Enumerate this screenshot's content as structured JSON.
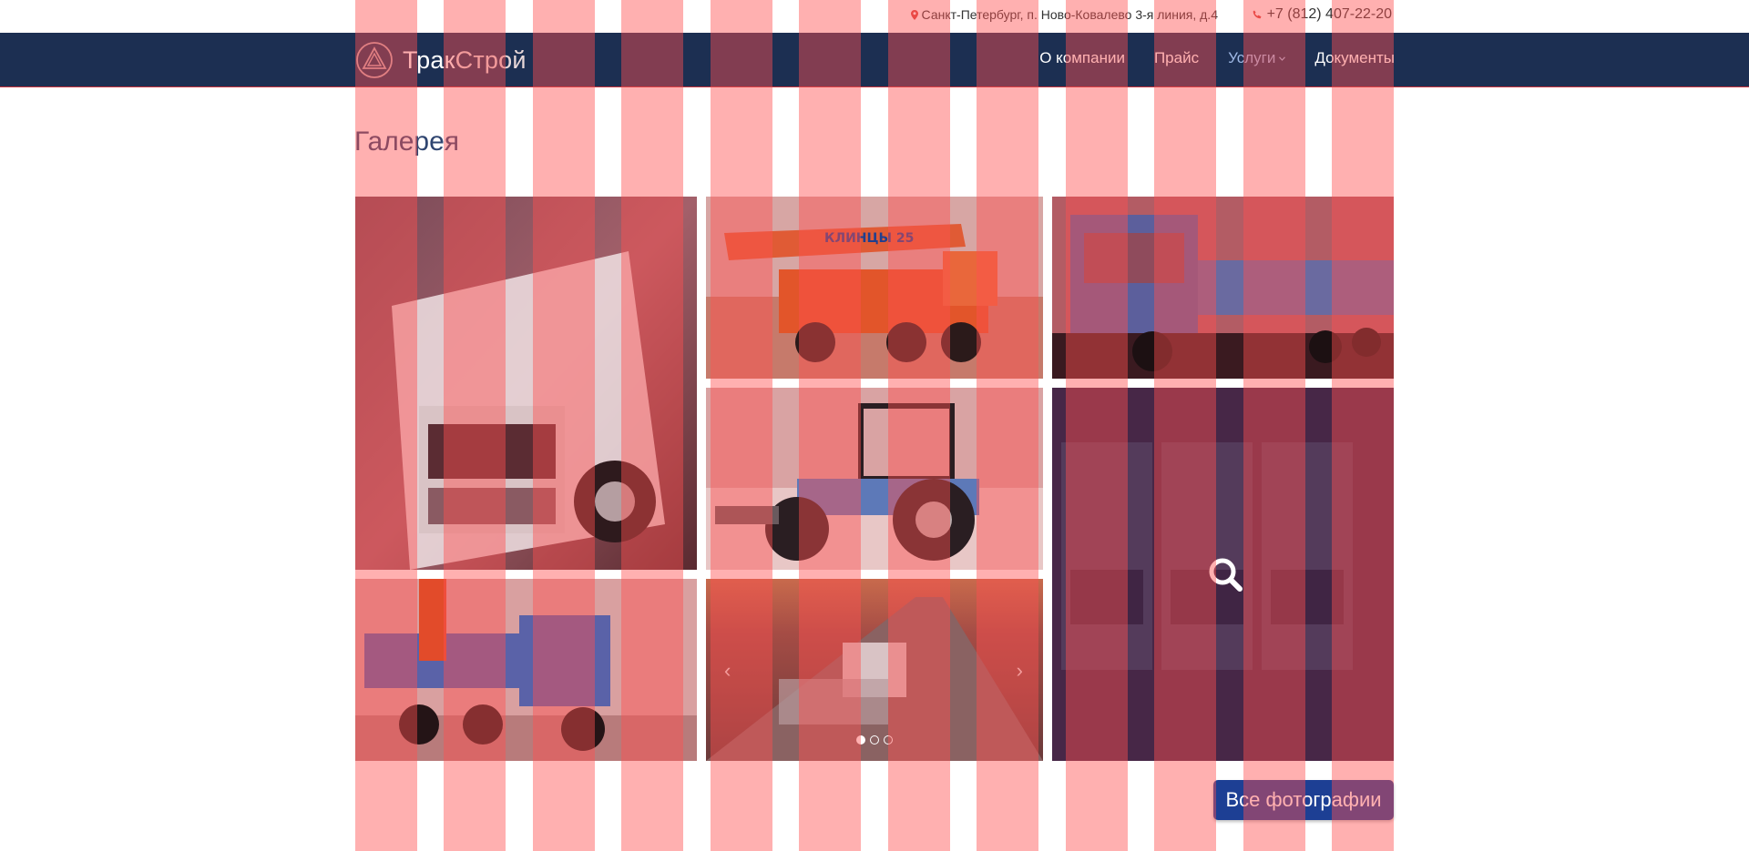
{
  "topbar": {
    "address": "Санкт-Петербург, п. Ново-Ковалево 3-я линия, д.4",
    "phone": "+7 (812) 407-22-20"
  },
  "logo": {
    "part1": "Трак",
    "part2": "Строй"
  },
  "nav": {
    "items": [
      {
        "label": "О компании"
      },
      {
        "label": "Прайс"
      },
      {
        "label": "Услуги"
      },
      {
        "label": "Документы"
      }
    ]
  },
  "page": {
    "title": "Галерея"
  },
  "gallery": {
    "photos": [
      {
        "icon": "white-truck-photo"
      },
      {
        "icon": "crane-truck-photo",
        "sign": "КЛИНЦЫ 25"
      },
      {
        "icon": "blue-flatbed-truck-photo"
      },
      {
        "icon": "blue-tractor-photo"
      },
      {
        "icon": "truck-fleet-photo"
      },
      {
        "icon": "crane-manipulator-truck-photo"
      },
      {
        "icon": "highway-sunset-photo"
      }
    ],
    "carousel": {
      "prev": "‹",
      "next": "›",
      "slides": 3,
      "active": 1
    },
    "zoom_icon": "search-icon"
  },
  "buttons": {
    "all_photos": "Все фотографии"
  },
  "colors": {
    "navbar": "#1c2f52",
    "accent_line": "#c8333c",
    "title": "#2f4570",
    "button": "#1d3f94",
    "stripe_overlay": "rgba(255,80,80,0.45)"
  }
}
